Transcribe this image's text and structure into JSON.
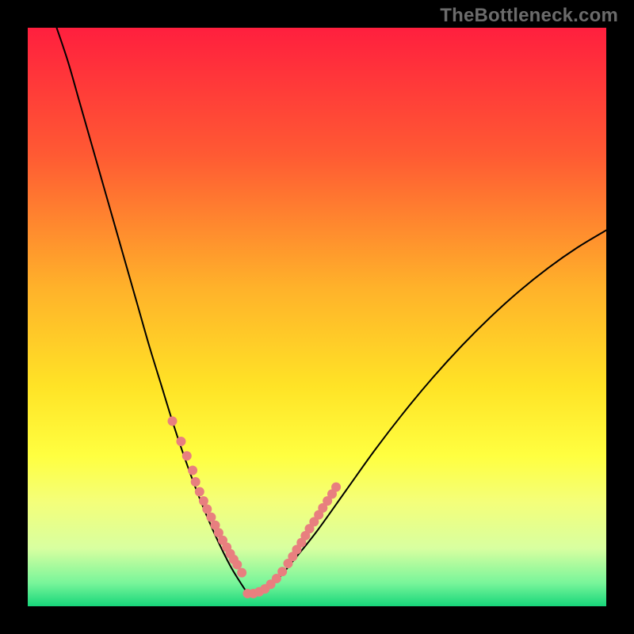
{
  "watermark": "TheBottleneck.com",
  "chart_data": {
    "type": "line",
    "title": "",
    "xlabel": "",
    "ylabel": "",
    "xlim": [
      0,
      100
    ],
    "ylim": [
      0,
      100
    ],
    "gradient_stops": [
      {
        "offset": 0.0,
        "color": "#ff1f3e"
      },
      {
        "offset": 0.22,
        "color": "#ff5a33"
      },
      {
        "offset": 0.45,
        "color": "#ffb22a"
      },
      {
        "offset": 0.62,
        "color": "#ffe326"
      },
      {
        "offset": 0.74,
        "color": "#ffff40"
      },
      {
        "offset": 0.82,
        "color": "#f4ff7a"
      },
      {
        "offset": 0.9,
        "color": "#d8ffa0"
      },
      {
        "offset": 0.96,
        "color": "#78f59a"
      },
      {
        "offset": 1.0,
        "color": "#17d67a"
      }
    ],
    "series": [
      {
        "name": "bottleneck-curve-left",
        "x": [
          5,
          7,
          9,
          11,
          13,
          15,
          17,
          19,
          21,
          23,
          25,
          27,
          29,
          31,
          33,
          35,
          36.5,
          38
        ],
        "y": [
          100,
          94,
          87,
          80,
          73,
          66,
          59,
          52,
          45,
          38.5,
          32,
          26,
          20.5,
          15.5,
          11,
          7,
          4.5,
          2.2
        ]
      },
      {
        "name": "bottleneck-curve-right",
        "x": [
          38,
          40,
          43,
          46,
          50,
          55,
          60,
          65,
          70,
          75,
          80,
          85,
          90,
          95,
          100
        ],
        "y": [
          2.2,
          2.5,
          4.5,
          8,
          13,
          20,
          27,
          33.5,
          39.5,
          45,
          50,
          54.5,
          58.5,
          62,
          65
        ]
      }
    ],
    "marker_points": {
      "name": "highlight-dots",
      "color": "#e87f7f",
      "x": [
        25,
        26.5,
        27.5,
        28.5,
        29,
        29.7,
        30.4,
        31,
        31.7,
        32.4,
        33,
        33.7,
        34.4,
        35,
        35.6,
        36.2,
        37,
        38,
        39,
        40,
        41,
        42,
        43,
        44,
        45,
        45.8,
        46.5,
        47.3,
        48,
        48.7,
        49.5,
        50.3,
        51,
        51.8,
        52.6,
        53.3
      ],
      "y": [
        32,
        28.5,
        26,
        23.5,
        21.5,
        19.8,
        18.2,
        16.8,
        15.4,
        14,
        12.7,
        11.4,
        10.2,
        9.1,
        8.1,
        7.2,
        5.8,
        2.2,
        2.2,
        2.5,
        3,
        3.8,
        4.8,
        6,
        7.4,
        8.6,
        9.8,
        11,
        12.2,
        13.4,
        14.6,
        15.8,
        17,
        18.2,
        19.4,
        20.6
      ]
    }
  }
}
